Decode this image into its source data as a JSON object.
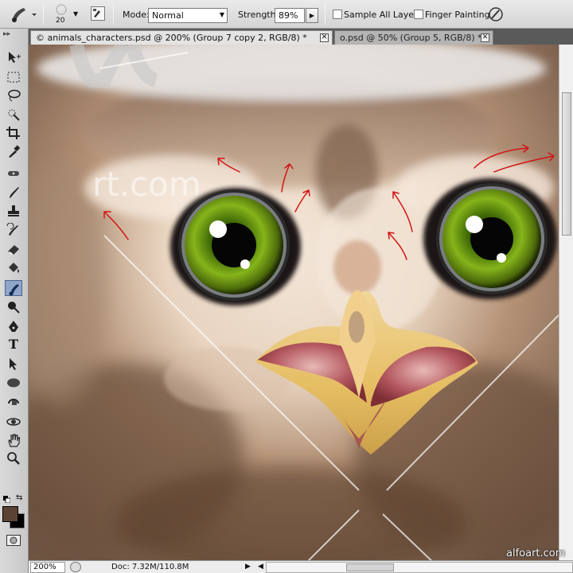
{
  "options_bar": {
    "brush_size": "20",
    "mode_label": "Mode:",
    "mode_value": "Normal",
    "strength_label": "Strength:",
    "strength_value": "89%",
    "sample_all_layers_label": "Sample All Layers",
    "finger_painting_label": "Finger Painting",
    "sample_all_layers_checked": false,
    "finger_painting_checked": false,
    "active_tool_icon": "smudge-tool-icon"
  },
  "tabs": [
    {
      "label": "© animals_characters.psd @ 200% (Group 7 copy 2, RGB/8) *",
      "active": true
    },
    {
      "label": "o.psd @ 50% (Group 5, RGB/8) *",
      "active": false
    }
  ],
  "toolbox": {
    "tools": [
      "move-tool-icon",
      "marquee-tool-icon",
      "lasso-tool-icon",
      "quick-selection-icon",
      "crop-tool-icon",
      "eyedropper-icon",
      "healing-brush-icon",
      "brush-tool-icon",
      "clone-stamp-icon",
      "history-brush-icon",
      "eraser-icon",
      "paint-bucket-icon",
      "smudge-tool-icon",
      "dodge-tool-icon",
      "pen-tool-icon",
      "type-tool-icon",
      "path-selection-icon",
      "ellipse-shape-icon",
      "3d-rotate-icon",
      "3d-orbit-icon",
      "hand-tool-icon",
      "zoom-tool-icon"
    ],
    "selected_tool": "smudge-tool-icon",
    "foreground_color": "#5b4334",
    "background_color": "#000000",
    "type_tool_letter": "T"
  },
  "canvas": {
    "background_text": "rt.com"
  },
  "statusbar": {
    "zoom": "200%",
    "doc_info": "Doc: 7.32M/110.8M"
  },
  "watermark": "alfoart.com"
}
